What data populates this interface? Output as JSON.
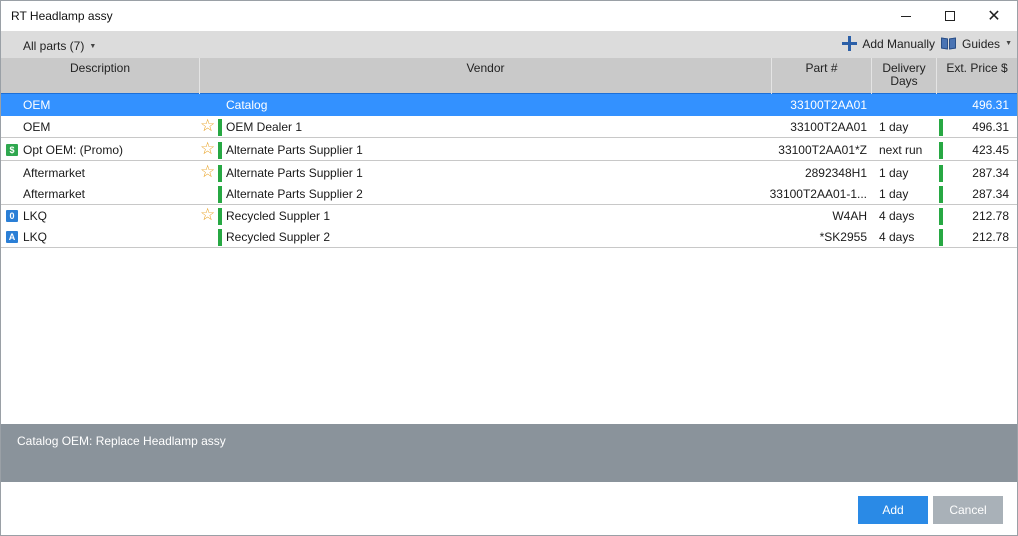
{
  "window": {
    "title": "RT Headlamp assy"
  },
  "toolbar": {
    "filter_label": "All parts (7)",
    "add_manually_label": "Add Manually",
    "guides_label": "Guides"
  },
  "columns": {
    "description": "Description",
    "vendor": "Vendor",
    "part": "Part #",
    "days_line1": "Delivery",
    "days_line2": "Days",
    "price": "Ext. Price $"
  },
  "rows": [
    {
      "badge": "",
      "description": "OEM",
      "starred": false,
      "vendor": "Catalog",
      "part": "33100T2AA01",
      "days": "",
      "price": "496.31",
      "selected": true
    },
    {
      "badge": "",
      "description": "OEM",
      "starred": true,
      "vendor": "OEM Dealer 1",
      "part": "33100T2AA01",
      "days": "1 day",
      "price": "496.31",
      "selected": false
    },
    {
      "badge": "$",
      "description": "Opt OEM: (Promo)",
      "starred": true,
      "vendor": "Alternate Parts Supplier 1",
      "part": "33100T2AA01*Z",
      "days": "next run",
      "price": "423.45",
      "selected": false
    },
    {
      "badge": "",
      "description": "Aftermarket",
      "starred": true,
      "vendor": "Alternate Parts Supplier 1",
      "part": "2892348H1",
      "days": "1 day",
      "price": "287.34",
      "selected": false
    },
    {
      "badge": "",
      "description": "Aftermarket",
      "starred": false,
      "vendor": "Alternate Parts Supplier 2",
      "part": "33100T2AA01-1...",
      "days": "1 day",
      "price": "287.34",
      "selected": false
    },
    {
      "badge": "0",
      "description": "LKQ",
      "starred": true,
      "vendor": "Recycled Suppler 1",
      "part": "W4AH",
      "days": "4 days",
      "price": "212.78",
      "selected": false
    },
    {
      "badge": "A",
      "description": "LKQ",
      "starred": false,
      "vendor": "Recycled Suppler 2",
      "part": "*SK2955",
      "days": "4 days",
      "price": "212.78",
      "selected": false
    }
  ],
  "info": {
    "text": "Catalog OEM: Replace Headlamp assy"
  },
  "buttons": {
    "add": "Add",
    "cancel": "Cancel"
  },
  "colors": {
    "accent": "#3391ff",
    "availability": "#27a843",
    "star": "#e8a020"
  }
}
